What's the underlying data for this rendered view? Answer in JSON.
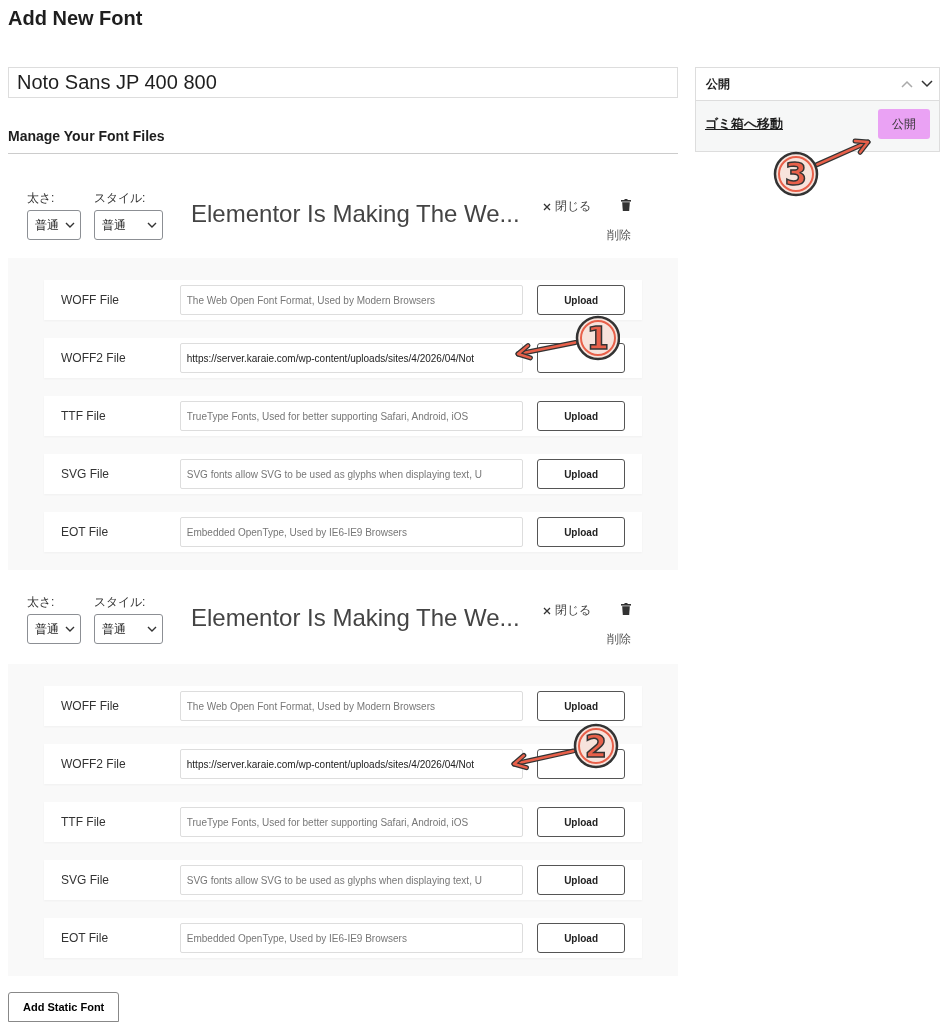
{
  "page_title": "Add New Font",
  "font_name": {
    "value": "Noto Sans JP 400 800"
  },
  "section_title": "Manage Your Font Files",
  "variations": [
    {
      "weight_label": "太さ:",
      "weight": "普通",
      "style_label": "スタイル:",
      "style": "普通",
      "preview": "Elementor Is Making The We...",
      "close": "閉じる",
      "delete": "削除",
      "files": [
        {
          "label": "WOFF File",
          "placeholder": "The Web Open Font Format, Used by Modern Browsers",
          "button": "Upload"
        },
        {
          "label": "WOFF2 File",
          "value": "https://server.karaie.com/wp-content/uploads/sites/4/2026/04/Not"
        },
        {
          "label": "TTF File",
          "placeholder": "TrueType Fonts, Used for better supporting Safari, Android, iOS",
          "button": "Upload"
        },
        {
          "label": "SVG File",
          "placeholder": "SVG fonts allow SVG to be used as glyphs when displaying text, U",
          "button": "Upload"
        },
        {
          "label": "EOT File",
          "placeholder": "Embedded OpenType, Used by IE6-IE9 Browsers",
          "button": "Upload"
        }
      ]
    },
    {
      "weight_label": "太さ:",
      "weight": "普通",
      "style_label": "スタイル:",
      "style": "普通",
      "preview": "Elementor Is Making The We...",
      "close": "閉じる",
      "delete": "削除",
      "files": [
        {
          "label": "WOFF File",
          "placeholder": "The Web Open Font Format, Used by Modern Browsers",
          "button": "Upload"
        },
        {
          "label": "WOFF2 File",
          "value": "https://server.karaie.com/wp-content/uploads/sites/4/2026/04/Not"
        },
        {
          "label": "TTF File",
          "placeholder": "TrueType Fonts, Used for better supporting Safari, Android, iOS",
          "button": "Upload"
        },
        {
          "label": "SVG File",
          "placeholder": "SVG fonts allow SVG to be used as glyphs when displaying text, U",
          "button": "Upload"
        },
        {
          "label": "EOT File",
          "placeholder": "Embedded OpenType, Used by IE6-IE9 Browsers",
          "button": "Upload"
        }
      ]
    }
  ],
  "add_button": "Add Static Font",
  "publish_box": {
    "title": "公開",
    "trash_link": "ゴミ箱へ移動",
    "publish_button": "公開"
  },
  "callouts": [
    {
      "number": "1"
    },
    {
      "number": "2"
    },
    {
      "number": "3"
    }
  ]
}
